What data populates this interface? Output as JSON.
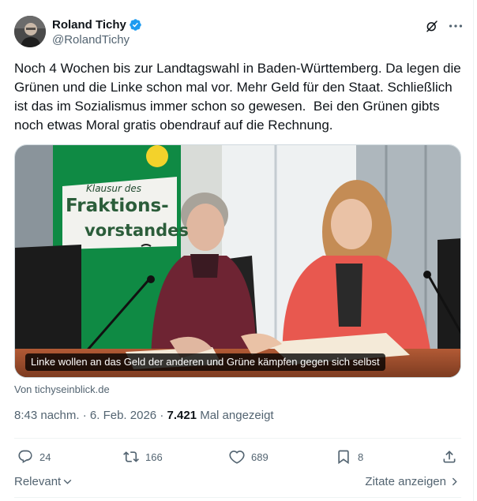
{
  "author": {
    "display_name": "Roland Tichy",
    "handle": "@RolandTichy",
    "verified": true,
    "verified_color": "#1d9bf0"
  },
  "tweet": {
    "text": "Noch 4 Wochen bis zur Landtagswahl in Baden-Württemberg. Da legen die Grünen und die Linke schon mal vor. Mehr Geld für den Staat. Schließlich ist das im Sozialismus immer schon so gewesen.  Bei den Grünen gibts noch etwas Moral gratis obendrauf auf die Rechnung."
  },
  "media": {
    "caption": "Linke wollen an das Geld der anderen und Grüne kämpfen gegen sich selbst",
    "sign_lines": [
      "Klausur des",
      "Fraktions-",
      "vorstandes"
    ],
    "source": "Von tichyseinblick.de"
  },
  "meta": {
    "time": "8:43 nachm.",
    "separator": "·",
    "date": "6. Feb. 2026",
    "views": "7.421",
    "views_label": "Mal angezeigt"
  },
  "actions": {
    "replies": "24",
    "reposts": "166",
    "likes": "689",
    "bookmarks": "8"
  },
  "footer": {
    "sort_label": "Relevant",
    "quotes_label": "Zitate anzeigen"
  },
  "icons": [
    "grok-icon",
    "more-icon",
    "verified-badge-icon",
    "reply-icon",
    "repost-icon",
    "like-icon",
    "bookmark-icon",
    "share-icon",
    "chevron-down-icon",
    "chevron-right-icon"
  ],
  "colors": {
    "text_primary": "#0f1419",
    "text_secondary": "#536471",
    "divider": "#eff3f4",
    "accent": "#1d9bf0"
  }
}
